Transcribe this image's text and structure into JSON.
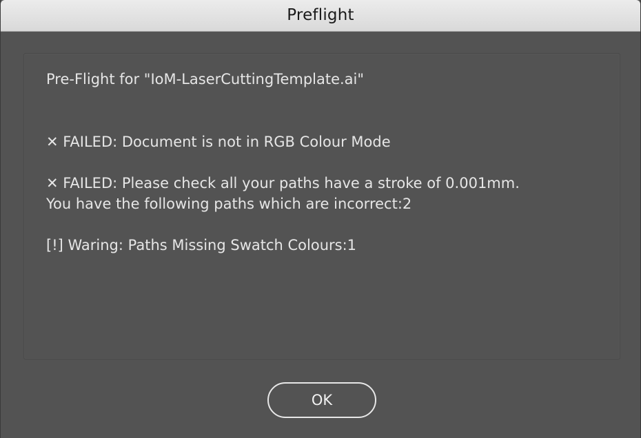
{
  "window": {
    "title": "Preflight"
  },
  "report": {
    "heading": "Pre-Flight for \"IoM-LaserCuttingTemplate.ai\"",
    "failed_colour_mode": "✕ FAILED: Document is not in RGB Colour Mode",
    "failed_stroke_line1": "✕ FAILED: Please check all your paths have a stroke of 0.001mm.",
    "failed_stroke_line2": "You have the following paths which are incorrect:2",
    "warning_swatch": "[!] Waring: Paths Missing Swatch Colours:1"
  },
  "buttons": {
    "ok_label": "OK"
  },
  "colors": {
    "background": "#535353",
    "titlebar": "#e3e3e3",
    "text": "#e6e6e6"
  }
}
